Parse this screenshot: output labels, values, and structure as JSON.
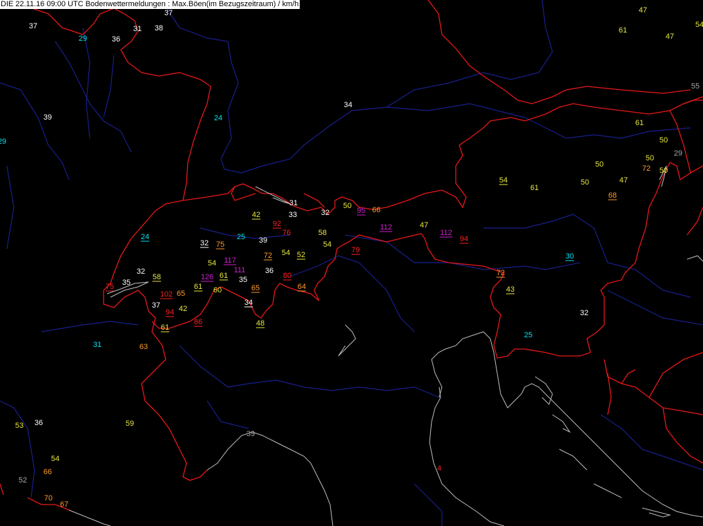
{
  "header": {
    "title": "DIE 22.11.16 09:00 UTC  Bodenwettermeldungen :  Max.Böen(im Bezugszeitraum) / km/h"
  },
  "colors": {
    "white": "#ffffff",
    "cyan": "#00e5ee",
    "yellow": "#e8e840",
    "orange": "#ff9a30",
    "red": "#ff2020",
    "magenta": "#d21ed2",
    "grey": "#a8a8a8",
    "border": "#e81818",
    "river": "#18208c",
    "coast": "#c0c0c0"
  },
  "stations": [
    {
      "v": "37",
      "c": "white"
    },
    {
      "v": "29",
      "c": "cyan"
    },
    {
      "v": "36",
      "c": "white"
    },
    {
      "v": "31",
      "c": "white"
    },
    {
      "v": "38",
      "c": "white"
    },
    {
      "v": "37",
      "c": "white"
    },
    {
      "v": "47",
      "c": "yellow"
    },
    {
      "v": "61",
      "c": "yellow"
    },
    {
      "v": "47",
      "c": "yellow"
    },
    {
      "v": "54",
      "c": "yellow"
    },
    {
      "v": "55",
      "c": "grey"
    },
    {
      "v": "39",
      "c": "white"
    },
    {
      "v": "24",
      "c": "cyan"
    },
    {
      "v": "29",
      "c": "cyan"
    },
    {
      "v": "34",
      "c": "white"
    },
    {
      "v": "61",
      "c": "yellow"
    },
    {
      "v": "50",
      "c": "yellow"
    },
    {
      "v": "29",
      "c": "grey"
    },
    {
      "v": "50",
      "c": "yellow"
    },
    {
      "v": "72",
      "c": "orange"
    },
    {
      "v": "50",
      "c": "yellow"
    },
    {
      "v": "50",
      "c": "yellow"
    },
    {
      "v": "50",
      "c": "yellow"
    },
    {
      "v": "47",
      "c": "yellow"
    },
    {
      "v": "54",
      "c": "yellow",
      "u": true
    },
    {
      "v": "61",
      "c": "yellow"
    },
    {
      "v": "68",
      "c": "orange",
      "u": true
    },
    {
      "v": "31",
      "c": "white"
    },
    {
      "v": "33",
      "c": "white"
    },
    {
      "v": "32",
      "c": "white"
    },
    {
      "v": "50",
      "c": "yellow"
    },
    {
      "v": "95",
      "c": "magenta",
      "u": true
    },
    {
      "v": "66",
      "c": "orange"
    },
    {
      "v": "42",
      "c": "yellow",
      "u": true
    },
    {
      "v": "92",
      "c": "red",
      "u": true
    },
    {
      "v": "76",
      "c": "red"
    },
    {
      "v": "58",
      "c": "yellow"
    },
    {
      "v": "112",
      "c": "magenta",
      "u": true
    },
    {
      "v": "47",
      "c": "yellow"
    },
    {
      "v": "112",
      "c": "magenta",
      "u": true
    },
    {
      "v": "94",
      "c": "red",
      "u": true
    },
    {
      "v": "24",
      "c": "cyan",
      "u": true
    },
    {
      "v": "32",
      "c": "white",
      "u": true
    },
    {
      "v": "75",
      "c": "orange",
      "u": true
    },
    {
      "v": "25",
      "c": "cyan"
    },
    {
      "v": "39",
      "c": "white"
    },
    {
      "v": "54",
      "c": "yellow"
    },
    {
      "v": "79",
      "c": "red",
      "u": true
    },
    {
      "v": "54",
      "c": "yellow"
    },
    {
      "v": "117",
      "c": "magenta",
      "u": true
    },
    {
      "v": "72",
      "c": "orange",
      "u": true
    },
    {
      "v": "54",
      "c": "yellow"
    },
    {
      "v": "52",
      "c": "yellow",
      "u": true
    },
    {
      "v": "111",
      "c": "magenta"
    },
    {
      "v": "36",
      "c": "white"
    },
    {
      "v": "32",
      "c": "white"
    },
    {
      "v": "58",
      "c": "yellow",
      "u": true
    },
    {
      "v": "126",
      "c": "magenta",
      "u": true
    },
    {
      "v": "61",
      "c": "yellow",
      "u": true
    },
    {
      "v": "35",
      "c": "white"
    },
    {
      "v": "80",
      "c": "red",
      "u": true
    },
    {
      "v": "35",
      "c": "white"
    },
    {
      "v": "75",
      "c": "red",
      "u": true
    },
    {
      "v": "61",
      "c": "yellow",
      "u": true
    },
    {
      "v": "60",
      "c": "yellow"
    },
    {
      "v": "65",
      "c": "orange",
      "u": true
    },
    {
      "v": "64",
      "c": "orange",
      "u": true
    },
    {
      "v": "102",
      "c": "red",
      "u": true
    },
    {
      "v": "65",
      "c": "orange"
    },
    {
      "v": "37",
      "c": "white"
    },
    {
      "v": "34",
      "c": "white",
      "u": true
    },
    {
      "v": "94",
      "c": "red",
      "u": true
    },
    {
      "v": "42",
      "c": "yellow"
    },
    {
      "v": "86",
      "c": "red",
      "u": true
    },
    {
      "v": "48",
      "c": "yellow",
      "u": true
    },
    {
      "v": "30",
      "c": "cyan",
      "u": true
    },
    {
      "v": "72",
      "c": "orange",
      "u": true
    },
    {
      "v": "43",
      "c": "yellow",
      "u": true
    },
    {
      "v": "32",
      "c": "white"
    },
    {
      "v": "25",
      "c": "cyan"
    },
    {
      "v": "61",
      "c": "yellow",
      "u": true
    },
    {
      "v": "31",
      "c": "cyan"
    },
    {
      "v": "63",
      "c": "orange"
    },
    {
      "v": "53",
      "c": "yellow"
    },
    {
      "v": "36",
      "c": "white"
    },
    {
      "v": "59",
      "c": "yellow"
    },
    {
      "v": "39",
      "c": "grey"
    },
    {
      "v": "54",
      "c": "yellow"
    },
    {
      "v": "66",
      "c": "orange"
    },
    {
      "v": "52",
      "c": "grey"
    },
    {
      "v": "70",
      "c": "orange"
    },
    {
      "v": "67",
      "c": "orange"
    },
    {
      "v": "4",
      "c": "red"
    }
  ]
}
